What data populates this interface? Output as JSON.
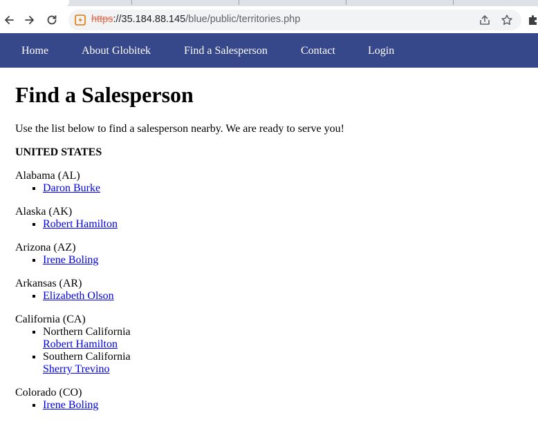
{
  "browser": {
    "url_scheme": "https",
    "url_host": "://35.184.88.145",
    "url_path": "/blue/public/territories.php"
  },
  "sitenav": {
    "items": [
      {
        "label": "Home"
      },
      {
        "label": "About Globitek"
      },
      {
        "label": "Find a Salesperson"
      },
      {
        "label": "Contact"
      },
      {
        "label": "Login"
      }
    ]
  },
  "page": {
    "title": "Find a Salesperson",
    "intro": "Use the list below to find a salesperson nearby. We are ready to serve you!",
    "country": "UNITED STATES"
  },
  "states": [
    {
      "name": "Alabama (AL)",
      "entries": [
        {
          "region": "",
          "person": "Daron Burke"
        }
      ]
    },
    {
      "name": "Alaska (AK)",
      "entries": [
        {
          "region": "",
          "person": "Robert Hamilton"
        }
      ]
    },
    {
      "name": "Arizona (AZ)",
      "entries": [
        {
          "region": "",
          "person": "Irene Boling"
        }
      ]
    },
    {
      "name": "Arkansas (AR)",
      "entries": [
        {
          "region": "",
          "person": "Elizabeth Olson"
        }
      ]
    },
    {
      "name": "California (CA)",
      "entries": [
        {
          "region": "Northern California",
          "person": "Robert Hamilton"
        },
        {
          "region": "Southern California",
          "person": "Sherry Trevino"
        }
      ]
    },
    {
      "name": "Colorado (CO)",
      "entries": [
        {
          "region": "",
          "person": "Irene Boling"
        }
      ]
    }
  ],
  "colors": {
    "nav_background": "#36478a",
    "link": "#0000ee",
    "insecure_scheme": "#e46b4f"
  },
  "icons": {
    "back": "back-arrow-icon",
    "forward": "forward-arrow-icon",
    "reload": "reload-icon",
    "security": "not-secure-warning-icon",
    "share": "share-icon",
    "bookmark": "star-icon",
    "extensions": "puzzle-icon"
  }
}
